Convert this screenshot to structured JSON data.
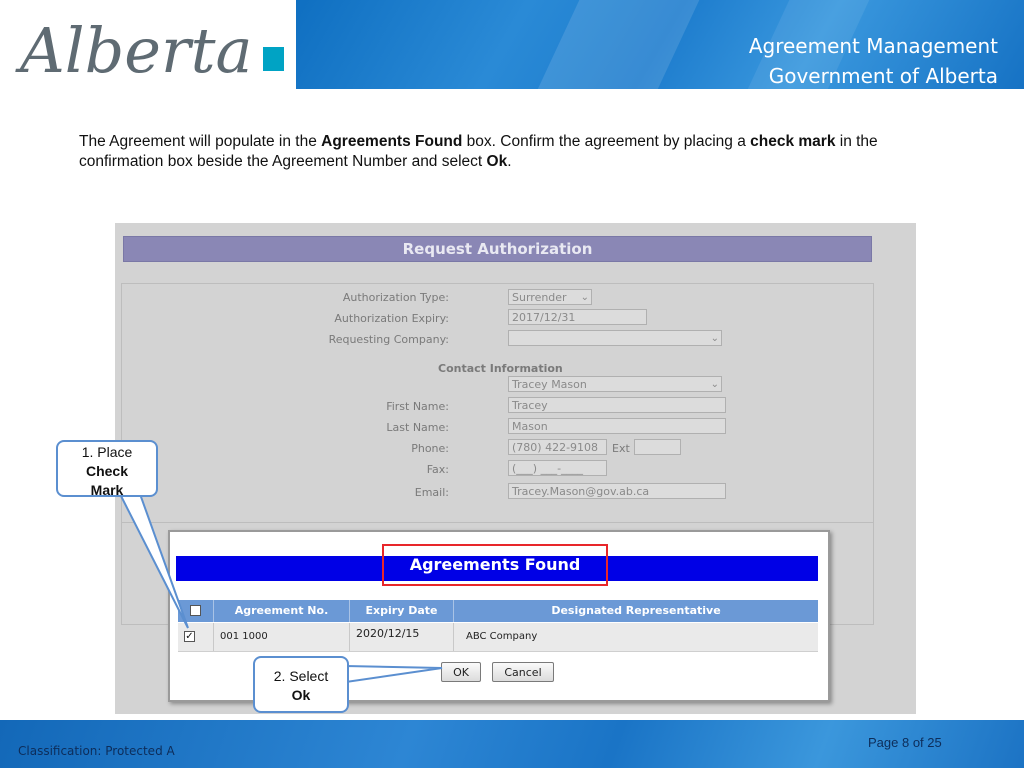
{
  "header": {
    "logo_text": "Alberta",
    "title_line1": "Agreement Management",
    "title_line2": "Government of Alberta"
  },
  "instructions": {
    "p1": "The Agreement will populate in the ",
    "b1": "Agreements Found",
    "p2": " box.  Confirm the agreement by placing a ",
    "b2": "check mark",
    "p3": " in the confirmation box beside the Agreement Number and select ",
    "b3": "Ok",
    "p4": "."
  },
  "request_form": {
    "title": "Request Authorization",
    "fields": {
      "authorization_type_label": "Authorization Type:",
      "authorization_type_value": "Surrender",
      "authorization_expiry_label": "Authorization Expiry:",
      "authorization_expiry_value": "2017/12/31",
      "requesting_company_label": "Requesting Company:",
      "requesting_company_value": "",
      "contact_information_heading": "Contact Information",
      "contact_value": "Tracey Mason",
      "first_name_label": "First Name:",
      "first_name_value": "Tracey",
      "last_name_label": "Last Name:",
      "last_name_value": "Mason",
      "phone_label": "Phone:",
      "phone_value": "(780) 422-9108",
      "ext_label": "Ext",
      "ext_value": "",
      "fax_label": "Fax:",
      "fax_value": "(___) ___-____",
      "email_label": "Email:",
      "email_value": "Tracey.Mason@gov.ab.ca"
    }
  },
  "agreements_dialog": {
    "title": "Agreements Found",
    "columns": [
      "Agreement No.",
      "Expiry Date",
      "Designated Representative"
    ],
    "rows": [
      {
        "agreement_no": "001 1000",
        "expiry_date": "2020/12/15",
        "representative": "ABC Company",
        "checked": true
      }
    ],
    "ok_label": "OK",
    "cancel_label": "Cancel"
  },
  "callouts": {
    "one_line1": "1.  Place",
    "one_line2": "Check",
    "one_line3": "Mark",
    "two_line1": "2.  Select",
    "two_line2": "Ok"
  },
  "footer": {
    "classification": "Classification: Protected A",
    "page": "Page 8 of 25"
  },
  "colors": {
    "banner_blue": "#1d7ccd",
    "agreements_bar": "#0000e6",
    "highlight_red": "#e8262a",
    "table_header": "#6b99d6",
    "logo_teal": "#00a3c4",
    "logo_gray": "#5f6b73"
  },
  "icons": {
    "check": "✓",
    "dropdown": "chevron-down-icon"
  }
}
